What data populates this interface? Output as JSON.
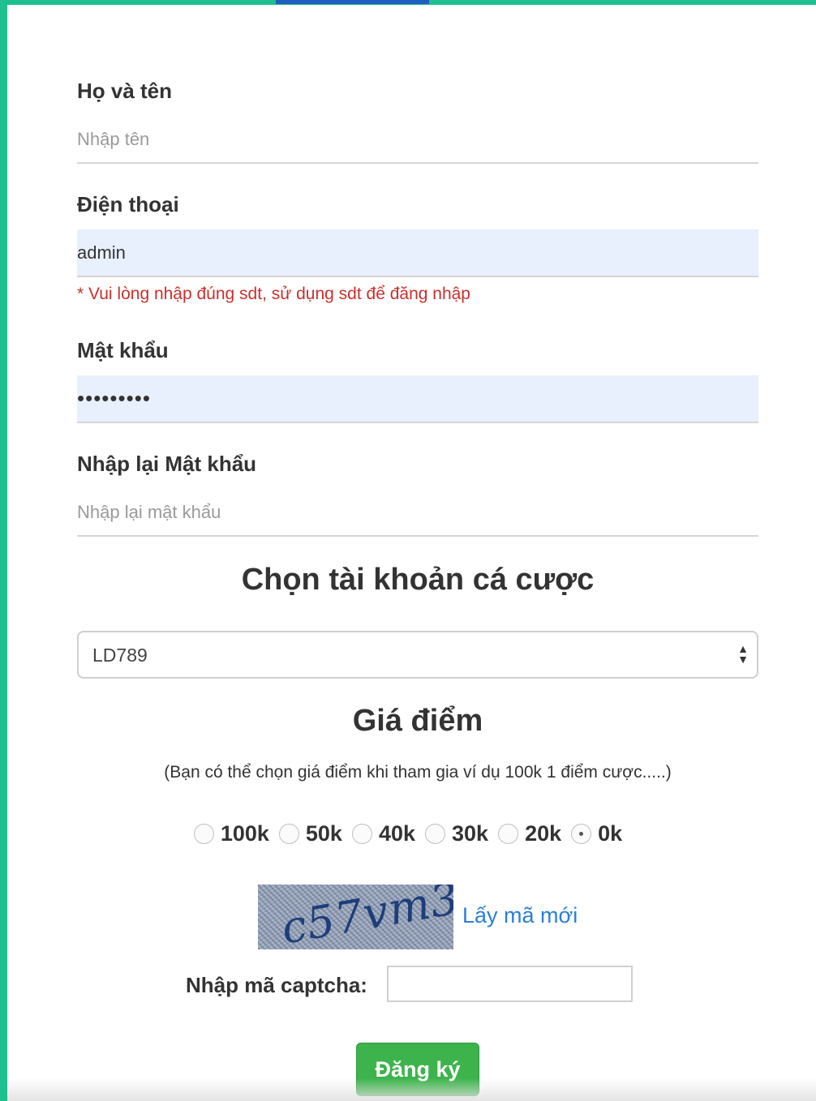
{
  "form": {
    "full_name": {
      "label": "Họ và tên",
      "placeholder": "Nhập tên",
      "value": ""
    },
    "phone": {
      "label": "Điện thoại",
      "placeholder": "",
      "value": "admin",
      "hint": "* Vui lòng nhập đúng sdt, sử dụng sdt để đăng nhập"
    },
    "password": {
      "label": "Mật khẩu",
      "value": "•••••••••"
    },
    "confirm_password": {
      "label": "Nhập lại Mật khẩu",
      "placeholder": "Nhập lại mật khẩu",
      "value": ""
    }
  },
  "account": {
    "title": "Chọn tài khoản cá cược",
    "selected": "LD789"
  },
  "price": {
    "title": "Giá điểm",
    "note": "(Bạn có thể chọn giá điểm khi tham gia ví dụ 100k 1 điểm cược.....)",
    "options": [
      {
        "label": "100k",
        "checked": false
      },
      {
        "label": "50k",
        "checked": false
      },
      {
        "label": "40k",
        "checked": false
      },
      {
        "label": "30k",
        "checked": false
      },
      {
        "label": "20k",
        "checked": false
      },
      {
        "label": "0k",
        "checked": true
      }
    ]
  },
  "captcha": {
    "image_text": "c57vm3",
    "refresh_label": "Lấy mã mới",
    "input_label": "Nhập mã captcha:",
    "input_value": ""
  },
  "submit_label": "Đăng ký",
  "colors": {
    "frame_accent": "#1fbf8f",
    "submit_bg": "#3cb44b",
    "hint_text": "#c9302c",
    "link": "#2a7fd4",
    "autofill_bg": "#e8f0fe"
  }
}
